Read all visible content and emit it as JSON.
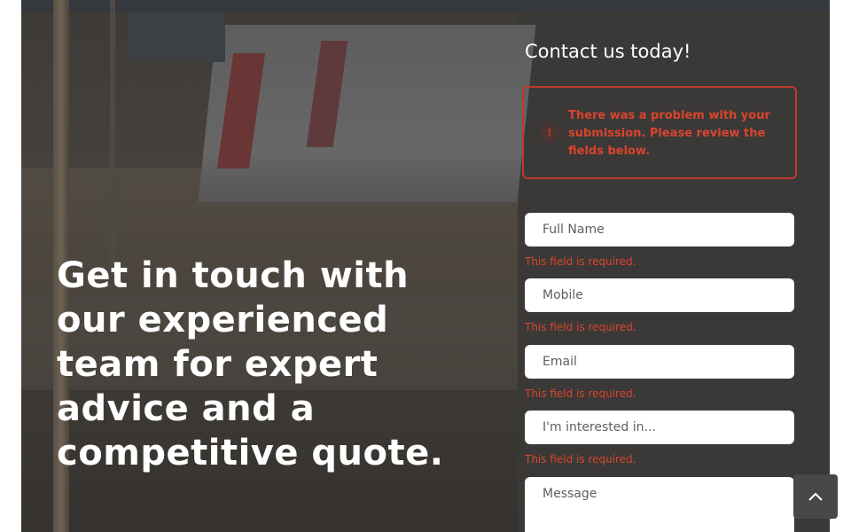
{
  "hero": {
    "headline": "Get in touch with our experienced team for expert advice and a competitive quote."
  },
  "form": {
    "title": "Contact us today!",
    "error_icon": "!",
    "error_message": "There was a problem with your submission. Please review the fields below.",
    "fields": [
      {
        "placeholder": "Full Name",
        "error": "This field is required."
      },
      {
        "placeholder": "Mobile",
        "error": "This field is required."
      },
      {
        "placeholder": "Email",
        "error": "This field is required."
      },
      {
        "placeholder": "I'm interested in...",
        "error": "This field is required."
      },
      {
        "placeholder": "Message"
      }
    ]
  },
  "colors": {
    "error": "#d9442e",
    "overlay": "#3b3937",
    "field_bg": "#ffffff"
  },
  "icons": {
    "error": "exclamation-icon",
    "back_to_top": "chevron-up-icon"
  }
}
